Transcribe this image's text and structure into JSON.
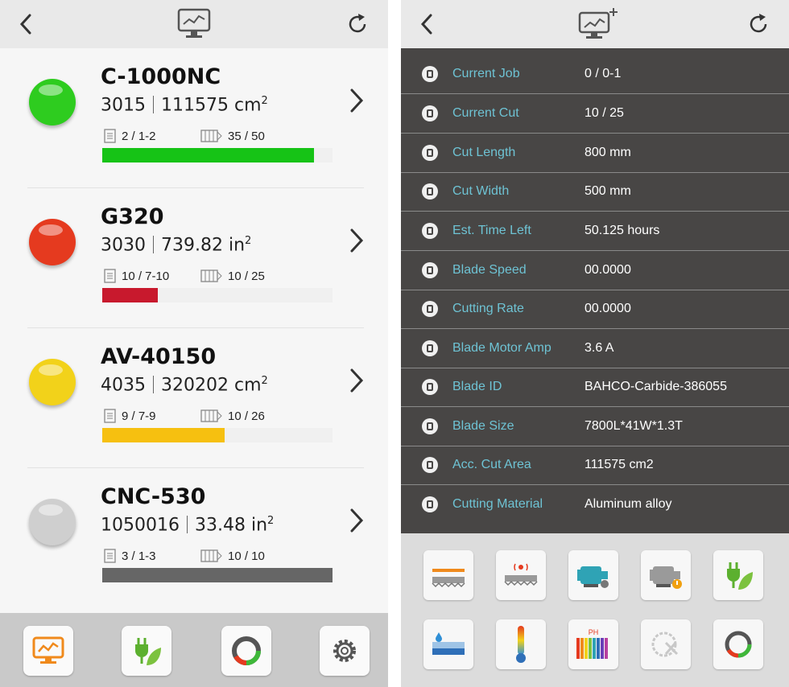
{
  "left": {
    "machines": [
      {
        "name": "C-1000NC",
        "count": "3015",
        "area": "111575 cm",
        "area_sup": "2",
        "job": "2 / 1-2",
        "cut": "35 / 50",
        "progress": 0.92,
        "status_color": "#2ecc1f",
        "bar_color": "#16c316"
      },
      {
        "name": "G320",
        "count": "3030",
        "area": "739.82 in",
        "area_sup": "2",
        "job": "10 / 7-10",
        "cut": "10 / 25",
        "progress": 0.24,
        "status_color": "#e53a1f",
        "bar_color": "#c8192d"
      },
      {
        "name": "AV-40150",
        "count": "4035",
        "area": "320202 cm",
        "area_sup": "2",
        "job": "9 / 7-9",
        "cut": "10 / 26",
        "progress": 0.53,
        "status_color": "#f2d21a",
        "bar_color": "#f6c010"
      },
      {
        "name": "CNC-530",
        "count": "1050016",
        "area": "33.48 in",
        "area_sup": "2",
        "job": "3 / 1-3",
        "cut": "10 / 10",
        "progress": 1.0,
        "status_color": "#cfcfcf",
        "bar_color": "#666666"
      }
    ],
    "toolbar": [
      "monitor-icon",
      "eco-plug-icon",
      "cycle-ring-icon",
      "gear-icon"
    ]
  },
  "right": {
    "rows": [
      {
        "label": "Current Job",
        "value": "0 / 0-1"
      },
      {
        "label": "Current Cut",
        "value": "10 / 25"
      },
      {
        "label": "Cut Length",
        "value": "800  mm"
      },
      {
        "label": "Cut Width",
        "value": "500  mm"
      },
      {
        "label": "Est. Time Left",
        "value": "50.125  hours"
      },
      {
        "label": "Blade Speed",
        "value": "00.0000"
      },
      {
        "label": "Cutting Rate",
        "value": "00.0000"
      },
      {
        "label": "Blade Motor Amp",
        "value": "3.6 A"
      },
      {
        "label": "Blade ID",
        "value": "BAHCO-Carbide-386055"
      },
      {
        "label": "Blade Size",
        "value": "7800L*41W*1.3T"
      },
      {
        "label": "Acc. Cut Area",
        "value": "111575 cm2"
      },
      {
        "label": "Cutting Material",
        "value": "Aluminum alloy"
      }
    ],
    "grid_icons": [
      "blade-icon",
      "blade-sensor-icon",
      "motor-icon",
      "motor-alert-icon",
      "eco-plug-icon",
      "coolant-tank-icon",
      "thermometer-icon",
      "ph-meter-icon",
      "saw-tool-icon",
      "cycle-ring-icon"
    ],
    "grid_ph_label": "PH"
  },
  "colors": {
    "accent_label": "#6ec3d4",
    "table_bg": "#484645",
    "toolbar_bg": "#c9c9c9"
  }
}
